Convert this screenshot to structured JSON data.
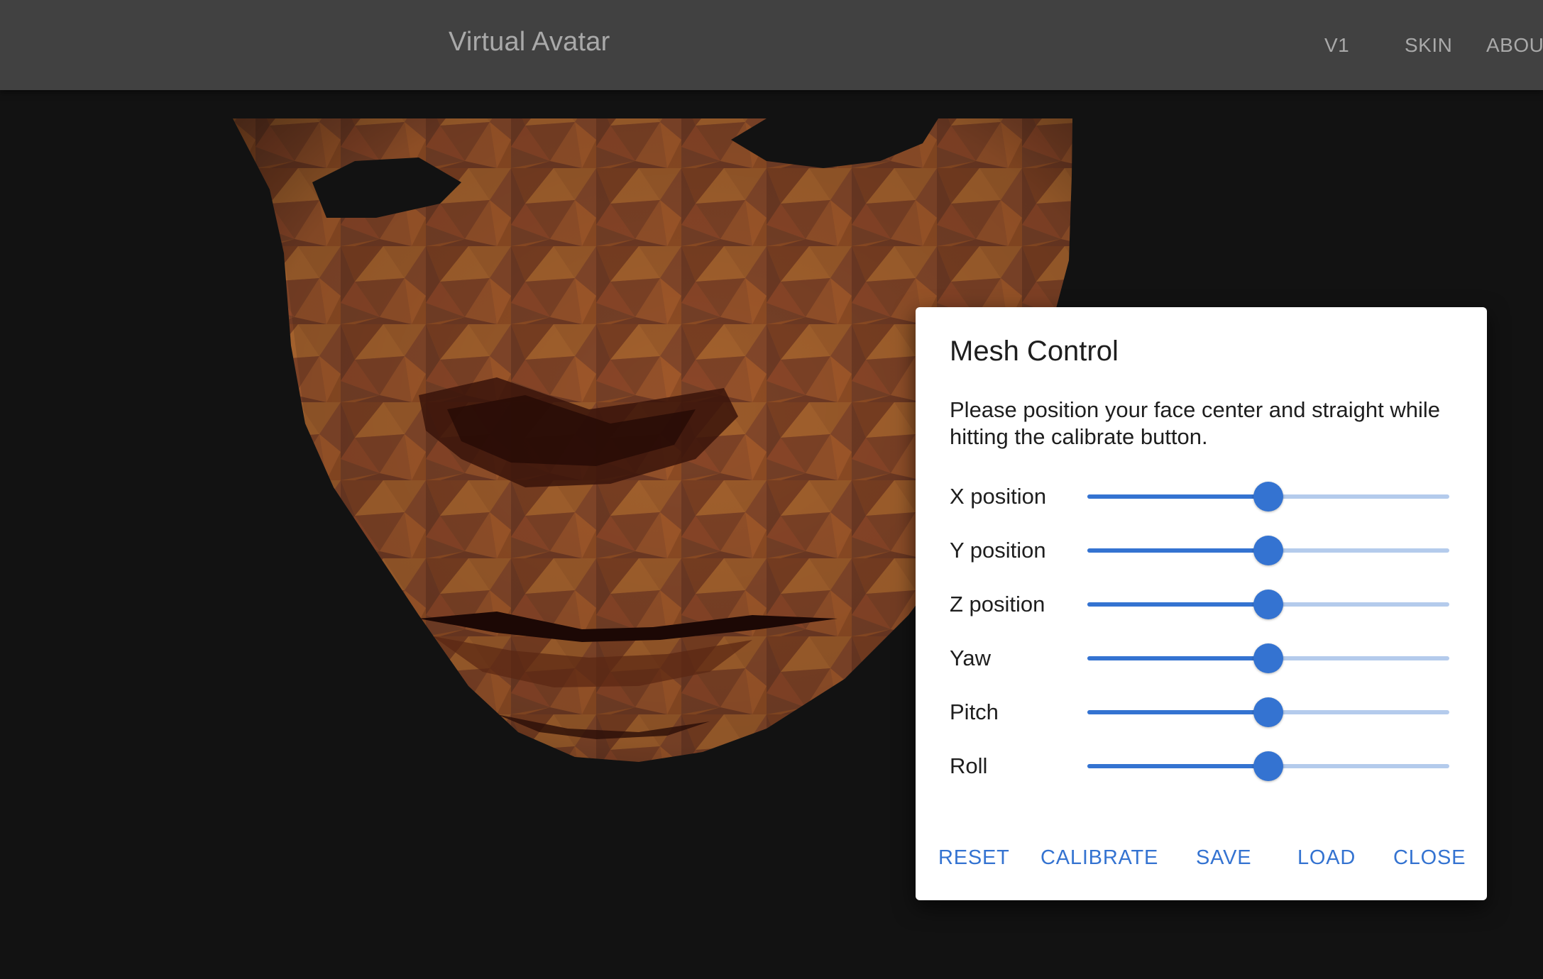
{
  "app": {
    "title": "Virtual Avatar",
    "nav": [
      "V1",
      "SKIN",
      "ABOU"
    ]
  },
  "dialog": {
    "title": "Mesh Control",
    "description": "Please position your face center and straight while hitting the calibrate button.",
    "sliders": [
      {
        "label": "X position",
        "value": 0.5
      },
      {
        "label": "Y position",
        "value": 0.5
      },
      {
        "label": "Z position",
        "value": 0.5
      },
      {
        "label": "Yaw",
        "value": 0.5
      },
      {
        "label": "Pitch",
        "value": 0.5
      },
      {
        "label": "Roll",
        "value": 0.5
      }
    ],
    "actions": [
      "RESET",
      "CALIBRATE",
      "SAVE",
      "LOAD",
      "CLOSE"
    ]
  },
  "colors": {
    "app_bar": "#414141",
    "background": "#121212",
    "accent": "#3473d1",
    "track": "#b4cbec",
    "mesh": "#8a4a22"
  },
  "icons": {
    "avatar": "face-mesh-icon"
  }
}
